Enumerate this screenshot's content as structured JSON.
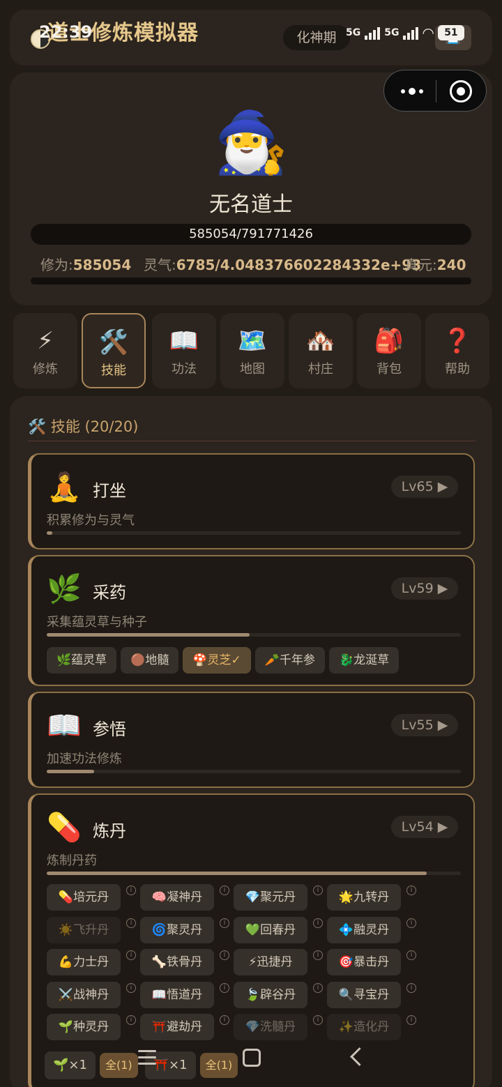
{
  "status_bar": {
    "time": "22:39",
    "network1": "5G",
    "network2": "5G",
    "battery": "51"
  },
  "header": {
    "title": "道士修炼模拟器",
    "realm": "化神期",
    "save_icon": "💾"
  },
  "profile": {
    "avatar": "🧙‍♂️",
    "name": "无名道士",
    "exp_text": "585054/791771426",
    "cultivation_label": "修为:",
    "cultivation_value": "585054",
    "qi_label": "灵气:",
    "qi_value": "6785/4.048376602284332e+93",
    "zhenyuan_label": "真元:",
    "zhenyuan_value": "240"
  },
  "tabs": [
    {
      "icon": "⚡",
      "label": "修炼"
    },
    {
      "icon": "🛠️",
      "label": "技能"
    },
    {
      "icon": "📖",
      "label": "功法"
    },
    {
      "icon": "🗺️",
      "label": "地图"
    },
    {
      "icon": "🏘️",
      "label": "村庄"
    },
    {
      "icon": "🎒",
      "label": "背包"
    },
    {
      "icon": "❓",
      "label": "帮助"
    }
  ],
  "skills_panel": {
    "title": "🛠️ 技能 (20/20)",
    "skills": [
      {
        "icon": "🧘",
        "name": "打坐",
        "level": "Lv65 ▶",
        "desc": "积累修为与灵气",
        "progress": 0.013
      },
      {
        "icon": "🌿",
        "name": "采药",
        "level": "Lv59 ▶",
        "desc": "采集蕴灵草与种子",
        "progress": 0.49
      },
      {
        "icon": "📖",
        "name": "参悟",
        "level": "Lv55 ▶",
        "desc": "加速功法修炼",
        "progress": 0.115
      },
      {
        "icon": "💊",
        "name": "炼丹",
        "level": "Lv54 ▶",
        "desc": "炼制丹药",
        "progress": 0.918
      }
    ],
    "herbs": [
      "🌿蕴灵草",
      "🟤地髓",
      "🍄灵芝✓",
      "🥕千年参",
      "🐉龙涎草"
    ],
    "pills": [
      "💊培元丹",
      "🧠凝神丹",
      "💎聚元丹",
      "🌟九转丹",
      "☀️飞升丹",
      "🌀聚灵丹",
      "💚回春丹",
      "💠融灵丹",
      "💪力士丹",
      "🦴铁骨丹",
      "⚡迅捷丹",
      "🎯暴击丹",
      "⚔️战神丹",
      "📖悟道丹",
      "🍃辟谷丹",
      "🔍寻宝丹",
      "🌱种灵丹",
      "⛩️避劫丹",
      "💎洗髓丹",
      "✨造化丹"
    ],
    "info_icon": "i",
    "bottom": {
      "qty1": "🌱×1",
      "all1": "全(1)",
      "qty2": "⛩️×1",
      "all2": "全(1)"
    }
  }
}
